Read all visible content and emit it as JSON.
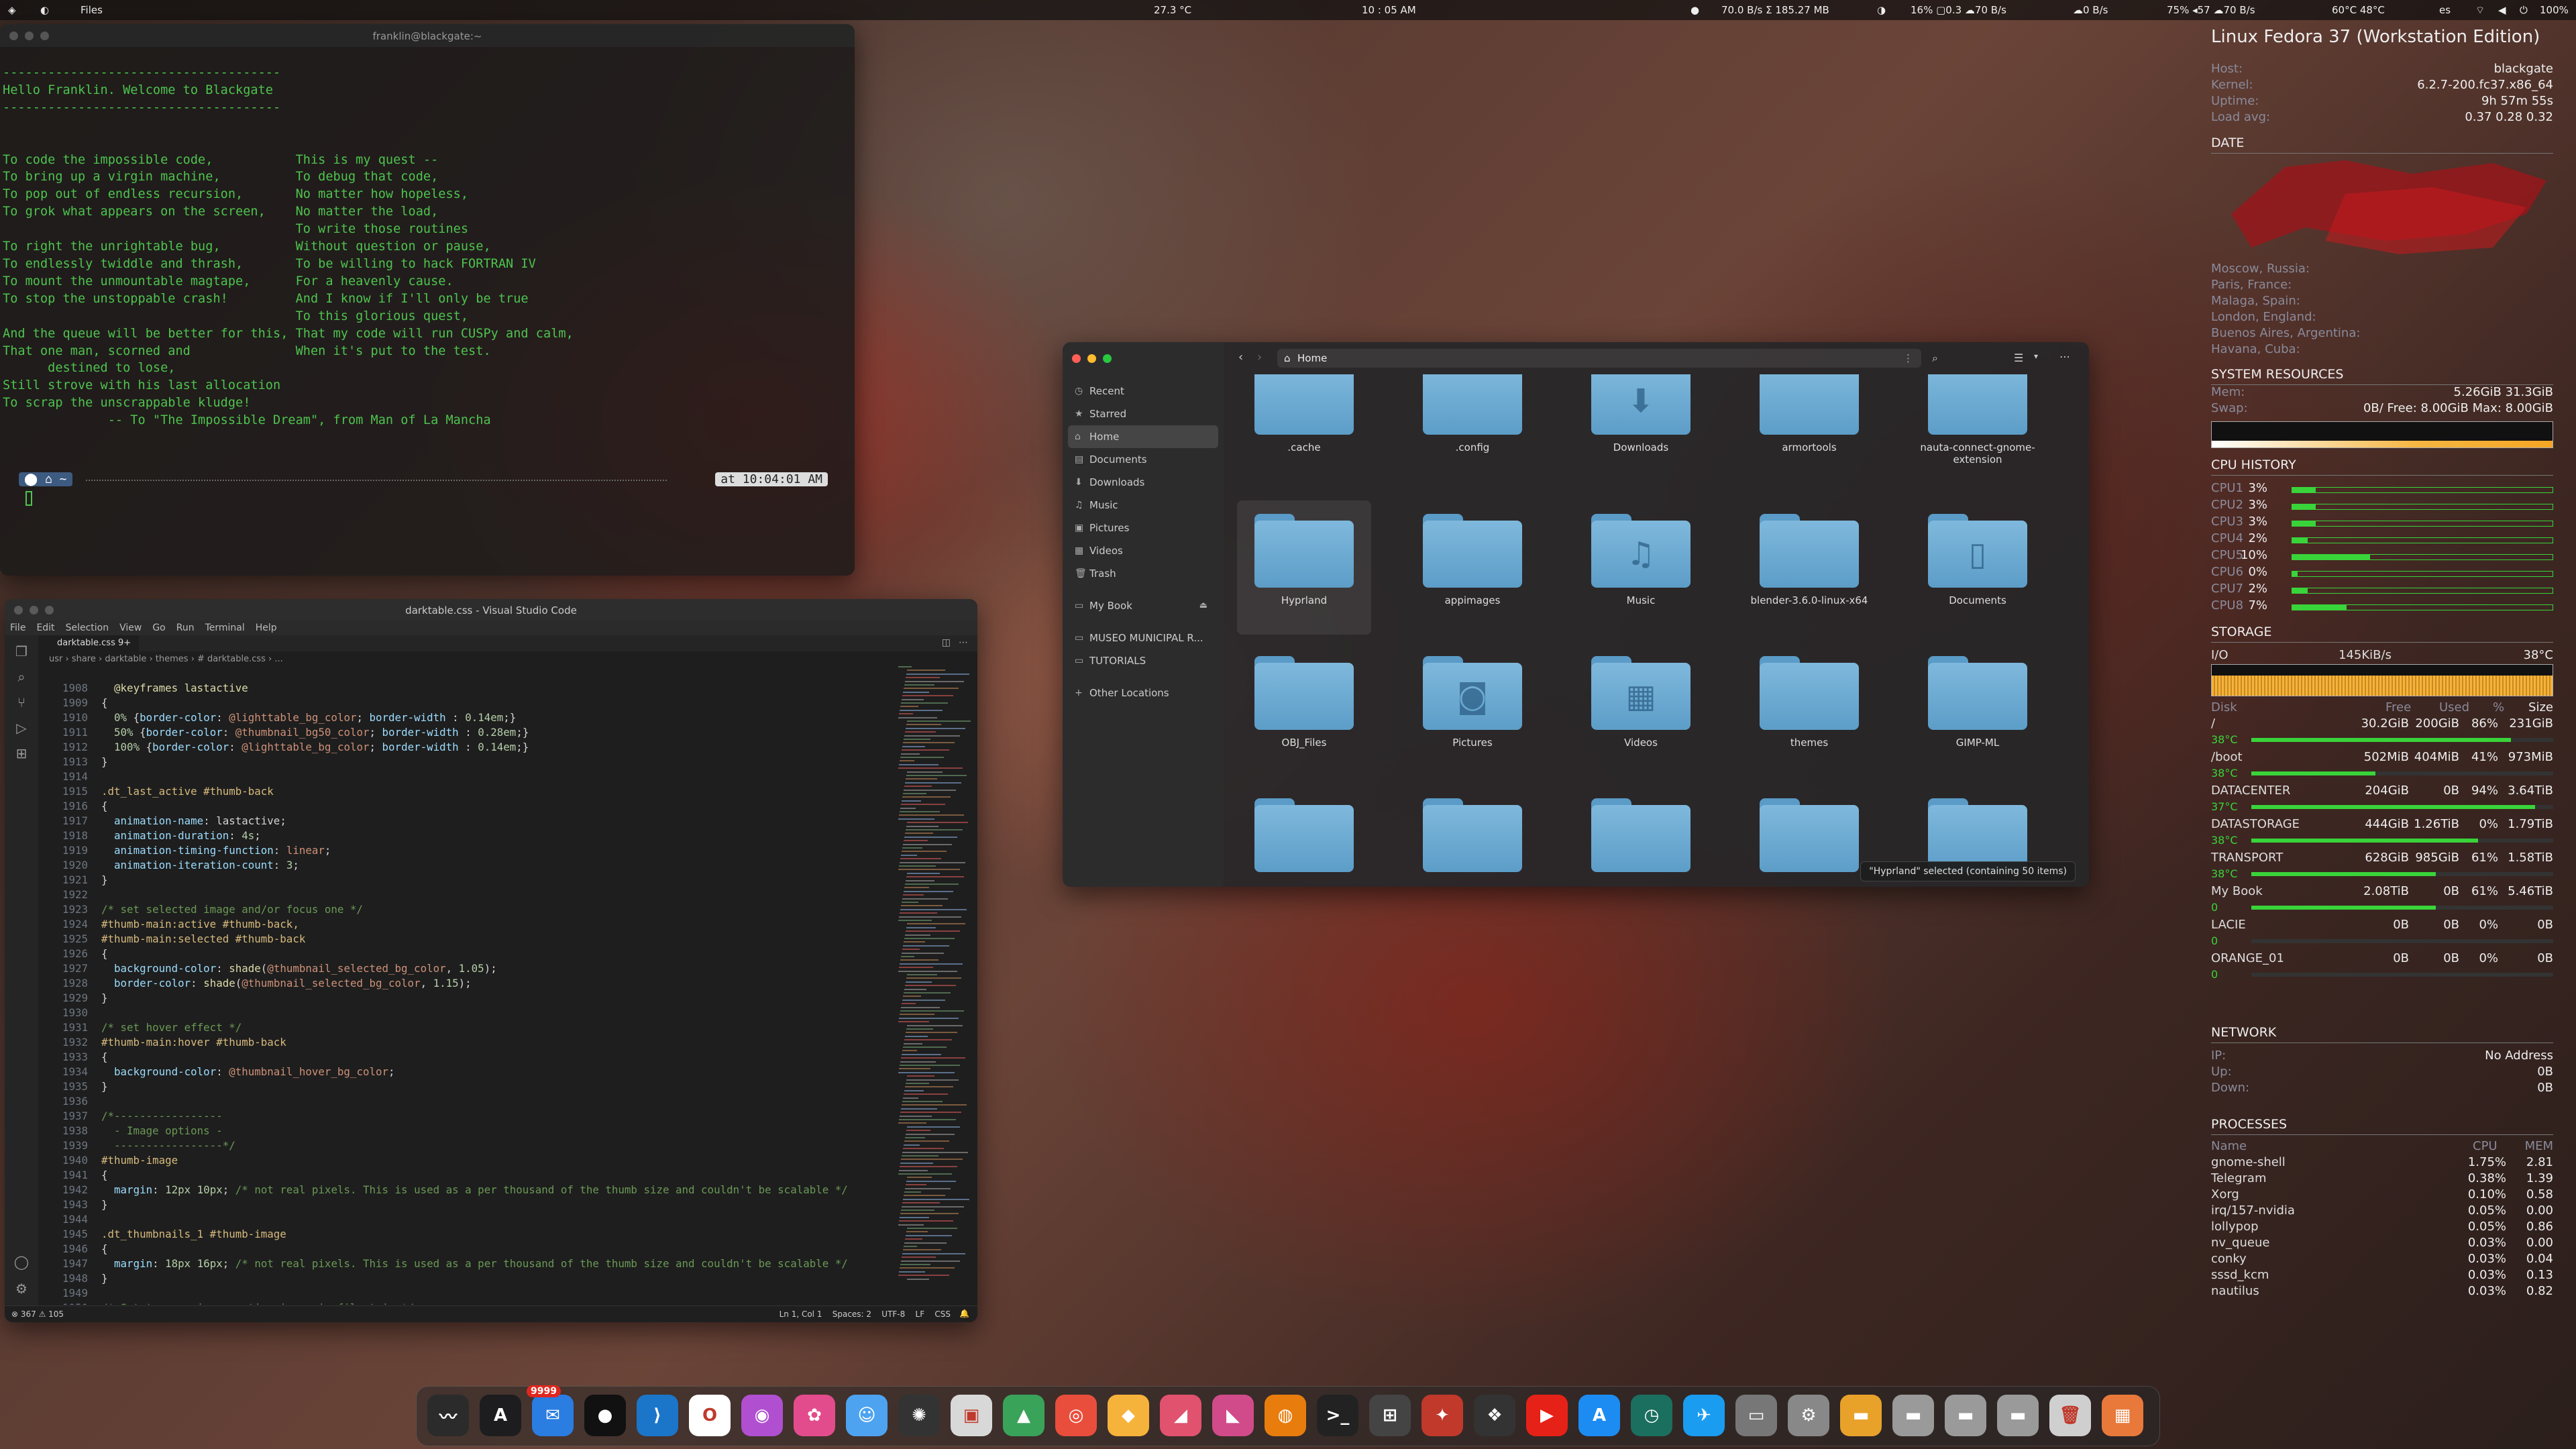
{
  "topbar": {
    "app_name": "Files",
    "temperature": "27.3 °C",
    "time": "10 : 05 AM",
    "net_io": "70.0  B/s  Σ  185.27 MB",
    "cpu_stats": "16%  ▢0.3  ☁70 B/s",
    "disk_io": "☁0 B/s",
    "mem_stats": "75%  ◂57  ☁70 B/s",
    "gpu_temps": "60°C  48°C",
    "lang": "es",
    "battery": "100%"
  },
  "terminal": {
    "title": "franklin@blackgate:~",
    "lines": [
      "-------------------------------------",
      "Hello Franklin. Welcome to Blackgate",
      "-------------------------------------",
      "",
      "",
      "To code the impossible code,           This is my quest --",
      "To bring up a virgin machine,          To debug that code,",
      "To pop out of endless recursion,       No matter how hopeless,",
      "To grok what appears on the screen,    No matter the load,",
      "                                       To write those routines",
      "To right the unrightable bug,          Without question or pause,",
      "To endlessly twiddle and thrash,       To be willing to hack FORTRAN IV",
      "To mount the unmountable magtape,      For a heavenly cause.",
      "To stop the unstoppable crash!         And I know if I'll only be true",
      "                                       To this glorious quest,",
      "And the queue will be better for this, That my code will run CUSPy and calm,",
      "That one man, scorned and              When it's put to the test.",
      "      destined to lose,",
      "Still strove with his last allocation",
      "To scrap the unscrappable kludge!",
      "              -- To \"The Impossible Dream\", from Man of La Mancha"
    ],
    "prompt_path": "~",
    "prompt_time": "at 10:04:01 AM"
  },
  "vscode": {
    "title": "darktable.css - Visual Studio Code",
    "menu": [
      "File",
      "Edit",
      "Selection",
      "View",
      "Go",
      "Run",
      "Terminal",
      "Help"
    ],
    "tab": "darktable.css 9+",
    "breadcrumb": "usr  ›  share  ›  darktable  ›  themes  ›  # darktable.css  ›  ...",
    "status_left": "⊗ 367  ⚠ 105",
    "status_right": "Ln 1, Col 1    Spaces: 2    UTF-8    LF    CSS"
  },
  "files": {
    "path": "Home",
    "sidebar": [
      {
        "icon": "◷",
        "label": "Recent"
      },
      {
        "icon": "★",
        "label": "Starred"
      },
      {
        "icon": "⌂",
        "label": "Home"
      },
      {
        "icon": "▤",
        "label": "Documents"
      },
      {
        "icon": "⬇",
        "label": "Downloads"
      },
      {
        "icon": "♫",
        "label": "Music"
      },
      {
        "icon": "▣",
        "label": "Pictures"
      },
      {
        "icon": "▦",
        "label": "Videos"
      },
      {
        "icon": "🗑",
        "label": "Trash"
      },
      {
        "icon": "▭",
        "label": "My Book"
      },
      {
        "icon": "▭",
        "label": "MUSEO MUNICIPAL R..."
      },
      {
        "icon": "▭",
        "label": "TUTORIALS"
      },
      {
        "icon": "+",
        "label": "Other Locations"
      }
    ],
    "folders": [
      {
        "label": ".cache",
        "glyph": ""
      },
      {
        "label": ".config",
        "glyph": ""
      },
      {
        "label": "Downloads",
        "glyph": "⬇"
      },
      {
        "label": "armortools",
        "glyph": ""
      },
      {
        "label": "nauta-connect-gnome-extension",
        "glyph": ""
      },
      {
        "label": "Hyprland",
        "glyph": ""
      },
      {
        "label": "appimages",
        "glyph": ""
      },
      {
        "label": "Music",
        "glyph": "♫"
      },
      {
        "label": "blender-3.6.0-linux-x64",
        "glyph": ""
      },
      {
        "label": "Documents",
        "glyph": "▯"
      },
      {
        "label": "OBJ_Files",
        "glyph": ""
      },
      {
        "label": "Pictures",
        "glyph": "◙"
      },
      {
        "label": "Videos",
        "glyph": "▦"
      },
      {
        "label": "themes",
        "glyph": ""
      },
      {
        "label": "GIMP-ML",
        "glyph": ""
      },
      {
        "label": "",
        "glyph": ""
      },
      {
        "label": "",
        "glyph": ""
      },
      {
        "label": "",
        "glyph": ""
      },
      {
        "label": "",
        "glyph": ""
      },
      {
        "label": "",
        "glyph": ""
      }
    ],
    "status": "\"Hyprland\" selected (containing 50 items)"
  },
  "conky": {
    "os": "Linux Fedora 37 (Workstation Edition)",
    "host": "blackgate",
    "kernel": "6.2.7-200.fc37.x86_64",
    "uptime": "9h 57m 55s",
    "load": "0.37 0.28 0.32",
    "date_header": "DATE",
    "cities": [
      "Moscow, Russia:",
      "Paris, France:",
      "Malaga, Spain:",
      "London, England:",
      "Buenos Aires, Argentina:",
      "Havana, Cuba:"
    ],
    "sysres_header": "SYSTEM RESOURCES",
    "mem": "5.26GiB 31.3GiB",
    "swap": "0B/ Free: 8.00GiB Max: 8.00GiB",
    "cpu_header": "CPU HISTORY",
    "cpus": [
      {
        "name": "CPU1",
        "pct": "3%",
        "v": 3
      },
      {
        "name": "CPU2",
        "pct": "3%",
        "v": 3
      },
      {
        "name": "CPU3",
        "pct": "3%",
        "v": 3
      },
      {
        "name": "CPU4",
        "pct": "2%",
        "v": 2
      },
      {
        "name": "CPU5",
        "pct": "10%",
        "v": 10
      },
      {
        "name": "CPU6",
        "pct": "0%",
        "v": 0
      },
      {
        "name": "CPU7",
        "pct": "2%",
        "v": 2
      },
      {
        "name": "CPU8",
        "pct": "7%",
        "v": 7
      }
    ],
    "storage_header": "STORAGE",
    "io": "145KiB/s",
    "io_temp": "38°C",
    "disk_cols": [
      "Disk",
      "Free",
      "Used",
      "%",
      "Size"
    ],
    "disks": [
      {
        "name": "/",
        "free": "30.2GiB",
        "used": "200GiB",
        "pct": "86%",
        "size": "231GiB",
        "temp": "38°C",
        "fill": 0.86
      },
      {
        "name": "/boot",
        "free": "502MiB",
        "used": "404MiB",
        "pct": "41%",
        "size": "973MiB",
        "temp": "38°C",
        "fill": 0.41
      },
      {
        "name": "DATACENTER",
        "free": "204GiB",
        "used": "0B",
        "pct": "94%",
        "size": "3.64TiB",
        "temp": "37°C",
        "fill": 0.94
      },
      {
        "name": "DATASTORAGE",
        "free": "444GiB",
        "used": "1.26TiB",
        "pct": "0%",
        "size": "1.79TiB",
        "temp": "38°C",
        "fill": 0.75
      },
      {
        "name": "TRANSPORT",
        "free": "628GiB",
        "used": "985GiB",
        "pct": "61%",
        "size": "1.58TiB",
        "temp": "38°C",
        "fill": 0.61
      },
      {
        "name": "My Book",
        "free": "2.08TiB",
        "used": "0B",
        "pct": "61%",
        "size": "5.46TiB",
        "temp": "0",
        "fill": 0.61
      },
      {
        "name": "LACIE",
        "free": "0B",
        "used": "0B",
        "pct": "0%",
        "size": "0B",
        "temp": "0",
        "fill": 0
      },
      {
        "name": "ORANGE_01",
        "free": "0B",
        "used": "0B",
        "pct": "0%",
        "size": "0B",
        "temp": "0",
        "fill": 0
      }
    ],
    "net_header": "NETWORK",
    "ip": "No Address",
    "up": "0B",
    "down": "0B",
    "proc_header": "PROCESSES",
    "proc_cols": [
      "Name",
      "CPU",
      "MEM"
    ],
    "procs": [
      {
        "name": "gnome-shell",
        "cpu": "1.75%",
        "mem": "2.81"
      },
      {
        "name": "Telegram",
        "cpu": "0.38%",
        "mem": "1.39"
      },
      {
        "name": "Xorg",
        "cpu": "0.10%",
        "mem": "0.58"
      },
      {
        "name": "irq/157-nvidia",
        "cpu": "0.05%",
        "mem": "0.00"
      },
      {
        "name": "lollypop",
        "cpu": "0.05%",
        "mem": "0.86"
      },
      {
        "name": "nv_queue",
        "cpu": "0.03%",
        "mem": "0.00"
      },
      {
        "name": "conky",
        "cpu": "0.03%",
        "mem": "0.04"
      },
      {
        "name": "sssd_kcm",
        "cpu": "0.03%",
        "mem": "0.13"
      },
      {
        "name": "nautilus",
        "cpu": "0.03%",
        "mem": "0.82"
      }
    ]
  },
  "dock": {
    "badge": "9999",
    "apps": [
      {
        "name": "activity-monitor-icon",
        "glyph": "〰",
        "bg": "#2b2b2b"
      },
      {
        "name": "affinity-icon",
        "glyph": "A",
        "bg": "#1d1d1f"
      },
      {
        "name": "mail-icon",
        "glyph": "✉",
        "bg": "#2a7de1"
      },
      {
        "name": "github-icon",
        "glyph": "●",
        "bg": "#111"
      },
      {
        "name": "vscode-icon",
        "glyph": "⟩",
        "bg": "#1b75c9"
      },
      {
        "name": "opera-icon",
        "glyph": "O",
        "bg": "#ffffff"
      },
      {
        "name": "firefox-icon",
        "glyph": "◉",
        "bg": "#b04fd0"
      },
      {
        "name": "lens-icon",
        "glyph": "✿",
        "bg": "#e34c8c"
      },
      {
        "name": "finder-icon",
        "glyph": "☺",
        "bg": "#4da3f0"
      },
      {
        "name": "aperture-icon",
        "glyph": "✺",
        "bg": "#333"
      },
      {
        "name": "preview-icon",
        "glyph": "▣",
        "bg": "#d8d8d8"
      },
      {
        "name": "maps-icon",
        "glyph": "▲",
        "bg": "#3aa35a"
      },
      {
        "name": "chrome-icon",
        "glyph": "◎",
        "bg": "#e94e3c"
      },
      {
        "name": "sketch-icon",
        "glyph": "◆",
        "bg": "#f6b33b"
      },
      {
        "name": "affinity-designer-icon",
        "glyph": "◢",
        "bg": "#e0526e"
      },
      {
        "name": "affinity-photo-icon",
        "glyph": "◣",
        "bg": "#d14b8a"
      },
      {
        "name": "blender-icon",
        "glyph": "◍",
        "bg": "#e87d0d"
      },
      {
        "name": "terminal-icon",
        "glyph": ">_",
        "bg": "#222"
      },
      {
        "name": "calculator-icon",
        "glyph": "⊞",
        "bg": "#444"
      },
      {
        "name": "compass-icon",
        "glyph": "✦",
        "bg": "#c0392b"
      },
      {
        "name": "davinci-icon",
        "glyph": "❖",
        "bg": "#333"
      },
      {
        "name": "youtube-icon",
        "glyph": "▶",
        "bg": "#e62117"
      },
      {
        "name": "app-store-icon",
        "glyph": "A",
        "bg": "#1c8cf2"
      },
      {
        "name": "clock-icon",
        "glyph": "◷",
        "bg": "#1b6f5f"
      },
      {
        "name": "bird-icon",
        "glyph": "✈",
        "bg": "#1a9cf0"
      },
      {
        "name": "disk-utility-icon",
        "glyph": "▭",
        "bg": "#777"
      },
      {
        "name": "settings-icon",
        "glyph": "⚙",
        "bg": "#888"
      },
      {
        "name": "folder-drive-icon",
        "glyph": "▬",
        "bg": "#e8a22a"
      },
      {
        "name": "drive-1-icon",
        "glyph": "▬",
        "bg": "#9a9a9a"
      },
      {
        "name": "drive-2-icon",
        "glyph": "▬",
        "bg": "#9a9a9a"
      },
      {
        "name": "drive-3-icon",
        "glyph": "▬",
        "bg": "#9a9a9a"
      },
      {
        "name": "trash-icon",
        "glyph": "🗑",
        "bg": "#cfcfcf"
      },
      {
        "name": "launchpad-icon",
        "glyph": "▦",
        "bg": "#e8793a"
      }
    ]
  }
}
